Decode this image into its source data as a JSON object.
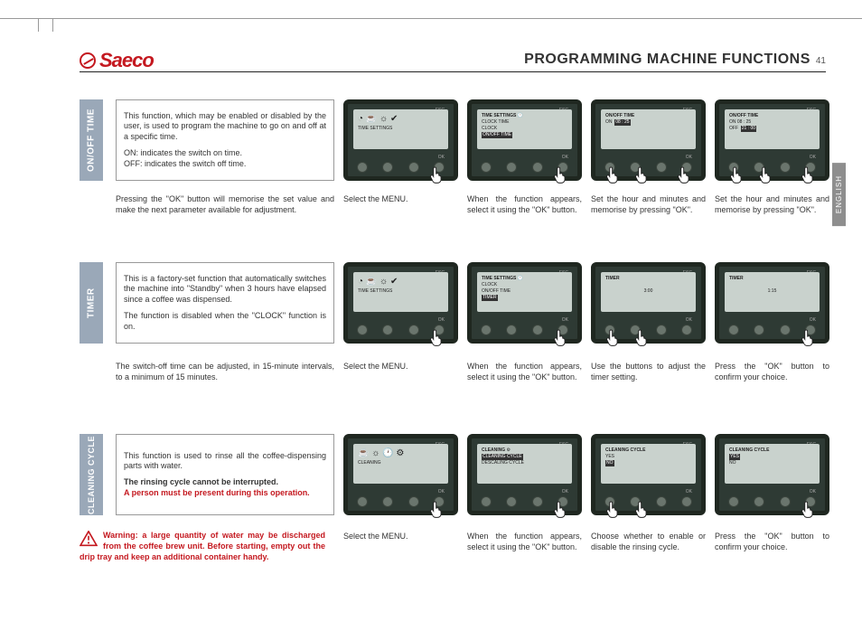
{
  "header": {
    "brand": "Saeco",
    "title": "PROGRAMMING MACHINE FUNCTIONS",
    "page": "41",
    "language_tab": "ENGLISH"
  },
  "sections": {
    "onoff": {
      "label": "ON/OFF TIME",
      "desc1": "This function, which may be enabled or disabled by the user, is used to program the machine to go on and off at a specific time.",
      "desc2": "ON: indicates the switch on time.",
      "desc3": "OFF: indicates the switch off time.",
      "caption0": "Pressing the \"OK\" button will memorise the set value and make the next parameter available for adjustment.",
      "cap1": "Select the MENU.",
      "cap2": "When the function appears, select it using the \"OK\" button.",
      "cap3": "Set the hour and minutes and memorise by pressing \"OK\".",
      "cap4": "Set the hour and minutes and memorise by pressing \"OK\".",
      "screen1": "TIME SETTINGS",
      "screen2a": "TIME SETTINGS",
      "screen2b": "CLOCK TIME",
      "screen2c": "CLOCK",
      "screen2d": "ON/OFF TIME",
      "screen3a": "ON/OFF TIME",
      "screen3b": "ON",
      "screen3c": "08 : 25",
      "screen4a": "ON/OFF TIME",
      "screen4b": "ON   08 : 25",
      "screen4c": "OFF",
      "screen4d": "21 : 00"
    },
    "timer": {
      "label": "TIMER",
      "desc1": "This is a factory-set function that automatically switches the machine into \"Standby\" when 3 hours have elapsed since a coffee was dispensed.",
      "desc2": "The function is disabled when the \"CLOCK\" function is on.",
      "caption0": "The switch-off time can be adjusted, in 15-minute intervals, to a minimum of 15 minutes.",
      "cap1": "Select the MENU.",
      "cap2": "When the function appears, select it using the \"OK\" button.",
      "cap3": "Use the buttons to adjust the timer setting.",
      "cap4": "Press the \"OK\" button to confirm your choice.",
      "screen1": "TIME SETTINGS",
      "screen2a": "TIME SETTINGS",
      "screen2b": "CLOCK",
      "screen2c": "ON/OFF TIME",
      "screen2d": "TIMER",
      "screen3a": "TIMER",
      "screen3b": "3:00",
      "screen4a": "TIMER",
      "screen4b": "1:15"
    },
    "cleaning": {
      "label": "CLEANING CYCLE",
      "desc1": "This function is used to rinse all the coffee-dispensing parts with water.",
      "desc2": "The rinsing cycle cannot be interrupted.",
      "desc3": "A person must be present during this operation.",
      "cap1": "Select the MENU.",
      "cap2": "When the function appears, select it using the \"OK\" button.",
      "cap3": "Choose whether to enable or disable the rinsing cycle.",
      "cap4": "Press the \"OK\" button to confirm your choice.",
      "screen1": "CLEANING",
      "screen2a": "CLEANING",
      "screen2b": "CLEANING CYCLE",
      "screen2c": "DESCALING CYCLE",
      "screen3a": "CLEANING CYCLE",
      "screen3b": "YES",
      "screen3c": "NO",
      "screen4a": "CLEANING CYCLE",
      "screen4b": "YES",
      "screen4c": "NO"
    }
  },
  "warning": "Warning: a large quantity of water may be discharged from the coffee brew unit. Before starting, empty out the drip tray and keep an additional container handy."
}
